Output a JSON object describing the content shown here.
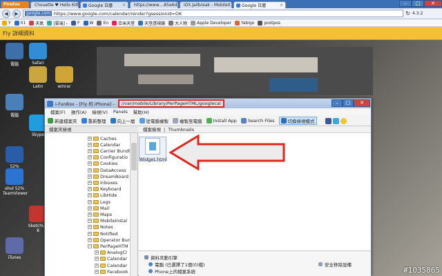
{
  "browser": {
    "app_button": "Firefox",
    "tabs": [
      {
        "label": "Chouette ♥ Hello Kitty ...",
        "color": "#e0457b",
        "active": false
      },
      {
        "label": "Google 日曆",
        "color": "#3c78d8",
        "active": false
      },
      {
        "label": "https://www....85e6d4a1ac",
        "color": "#777777",
        "active": false
      },
      {
        "label": "iOS Jailbreak - Mobile01",
        "color": "#5b8f2a",
        "active": false
      },
      {
        "label": "Google 日曆",
        "color": "#3c78d8",
        "active": true
      }
    ],
    "url_domain": "google.com",
    "url": "https://www.google.com/calendar/render?gsessionid=OK",
    "version": "4.3.2",
    "bookmarks": [
      "Y",
      "01",
      "天氣",
      "[雲端] -",
      "F",
      "W",
      "En",
      "亞米天堂",
      "天堂透視鏡",
      "大人物",
      "Apple Developer",
      "Yabigo",
      "postpos"
    ],
    "notification": "Fly 詳細資料"
  },
  "desktop_icons": [
    {
      "label": "電腦",
      "color": "#3f6fa8"
    },
    {
      "label": "Safari",
      "color": "#2f8ed6"
    },
    {
      "label": "Latin",
      "color": "#c9a640"
    },
    {
      "label": "winrar",
      "color": "#d0a538"
    },
    {
      "label": "電腦",
      "color": "#4a7fb8"
    },
    {
      "label": "Skype",
      "color": "#1e9ee0"
    },
    {
      "label": "52%",
      "color": "#2b5ca8"
    },
    {
      "label": "ohol 52% TeamViewer",
      "color": "#2b74d1"
    },
    {
      "label": "iTunes",
      "color": "#5f6aa8"
    },
    {
      "label": "SketchUp 8",
      "color": "#c2372d"
    }
  ],
  "window": {
    "title_prefix": "i-FunBox - [Fly 的 iPhone] - ",
    "title_path": "//var/mobile/Library/PerPageHTML/googlecal",
    "menu": [
      "檔案(F)",
      "操作(A)",
      "檢視(V)",
      "Panels",
      "幫助(H)"
    ],
    "toolbar": [
      "新建檔案夾",
      "重新整理",
      "向上一層",
      "從電腦複製",
      "複製至電腦",
      "Install App",
      "Search Files",
      "切換檢視模式"
    ],
    "tree_header": "檔案夾檢視",
    "tree": [
      "Caches",
      "Calendar",
      "Carrier Bundl",
      "Configuratio",
      "Cookies",
      "DataAccess",
      "DreamBoard",
      "Inboxes",
      "Keyboard",
      "LibHide",
      "Logs",
      "Mail",
      "Maps",
      "MobileInstal",
      "Notes",
      "Notified",
      "Operator Bun",
      "PerPageHTM",
      "AnalogCl",
      "Calendar",
      "Calendar",
      "Facebook"
    ],
    "content_header": [
      "檔案檢視",
      "Thumbnails"
    ],
    "file_name": "Widget.html",
    "prop_title": "資料夾動引擎",
    "prop_lines": [
      "電腦 (已選擇了1個(0)檔)",
      "Phone上的檔案系統"
    ],
    "prop_right": "安全移除設備"
  },
  "watermark": "#1035865",
  "colors": {
    "highlight_red": "#e0261c",
    "notif": "#f5c036"
  }
}
